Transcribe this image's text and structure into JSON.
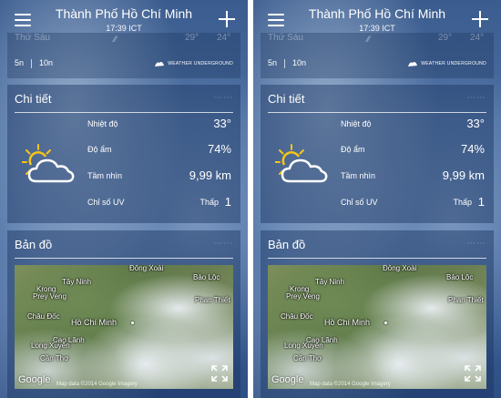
{
  "header": {
    "city": "Thành Phố Hồ Chí Minh",
    "time": "17:39 ICT"
  },
  "forecast": {
    "faded_day": "Thứ Sáu",
    "faded_rain": "⁄⁄",
    "faded_high": "29°",
    "faded_low": "24°",
    "range_5": "5n",
    "range_10": "10n",
    "provider": "WEATHER UNDERGROUND"
  },
  "details": {
    "title": "Chi tiết",
    "temp_label": "Nhiệt độ",
    "temp_value": "33°",
    "humidity_label": "Độ ẩm",
    "humidity_value": "74%",
    "visibility_label": "Tầm nhìn",
    "visibility_value": "9,99 km",
    "uv_label": "Chỉ số UV",
    "uv_level": "Thấp",
    "uv_value": "1"
  },
  "map": {
    "title": "Bản đồ",
    "labels": {
      "dong_xoai": "Đồng Xoài",
      "tay_ninh": "Tây Ninh",
      "bao_loc": "Bảo Lộc",
      "krong": "Krong",
      "prey_veng": "Prey Veng",
      "phan_thiet": "Phan Thiết",
      "chau_doc": "Châu Đốc",
      "ho_chi_minh": "Hồ Chí Minh",
      "cao_lanh": "Cao Lãnh",
      "long_xuyen": "Long Xuyên",
      "can_tho": "Cần Thơ"
    },
    "google": "Google",
    "copyright": "Map data ©2014 Google Imagery"
  },
  "colors": {
    "accent": "#ffffff",
    "sun": "#f5c518"
  },
  "icons": {
    "menu": "hamburger-icon",
    "add": "plus-icon",
    "weather": "partly-cloudy-icon",
    "expand": "expand-icon"
  }
}
